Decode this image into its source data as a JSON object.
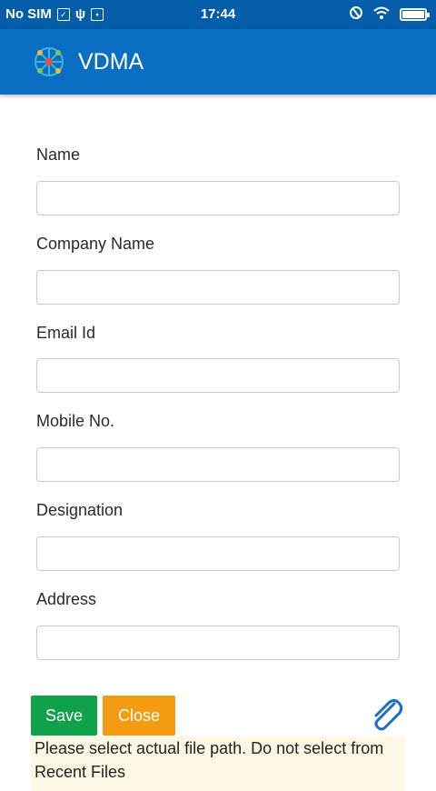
{
  "status_bar": {
    "carrier": "No SIM",
    "time": "17:44"
  },
  "app_bar": {
    "title": "VDMA"
  },
  "form": {
    "fields": [
      {
        "label": "Name",
        "value": ""
      },
      {
        "label": "Company Name",
        "value": ""
      },
      {
        "label": "Email Id",
        "value": ""
      },
      {
        "label": "Mobile No.",
        "value": ""
      },
      {
        "label": "Designation",
        "value": ""
      },
      {
        "label": "Address",
        "value": ""
      }
    ]
  },
  "actions": {
    "save_label": "Save",
    "close_label": "Close"
  },
  "notice": "Please select actual file path. Do not select from Recent Files",
  "colors": {
    "status_bar": "#045da8",
    "app_bar": "#0a6fc2",
    "save": "#0fa24a",
    "close": "#f39c12",
    "notice_bg": "#fcf8e3",
    "attach_icon": "#1a6fc0"
  }
}
